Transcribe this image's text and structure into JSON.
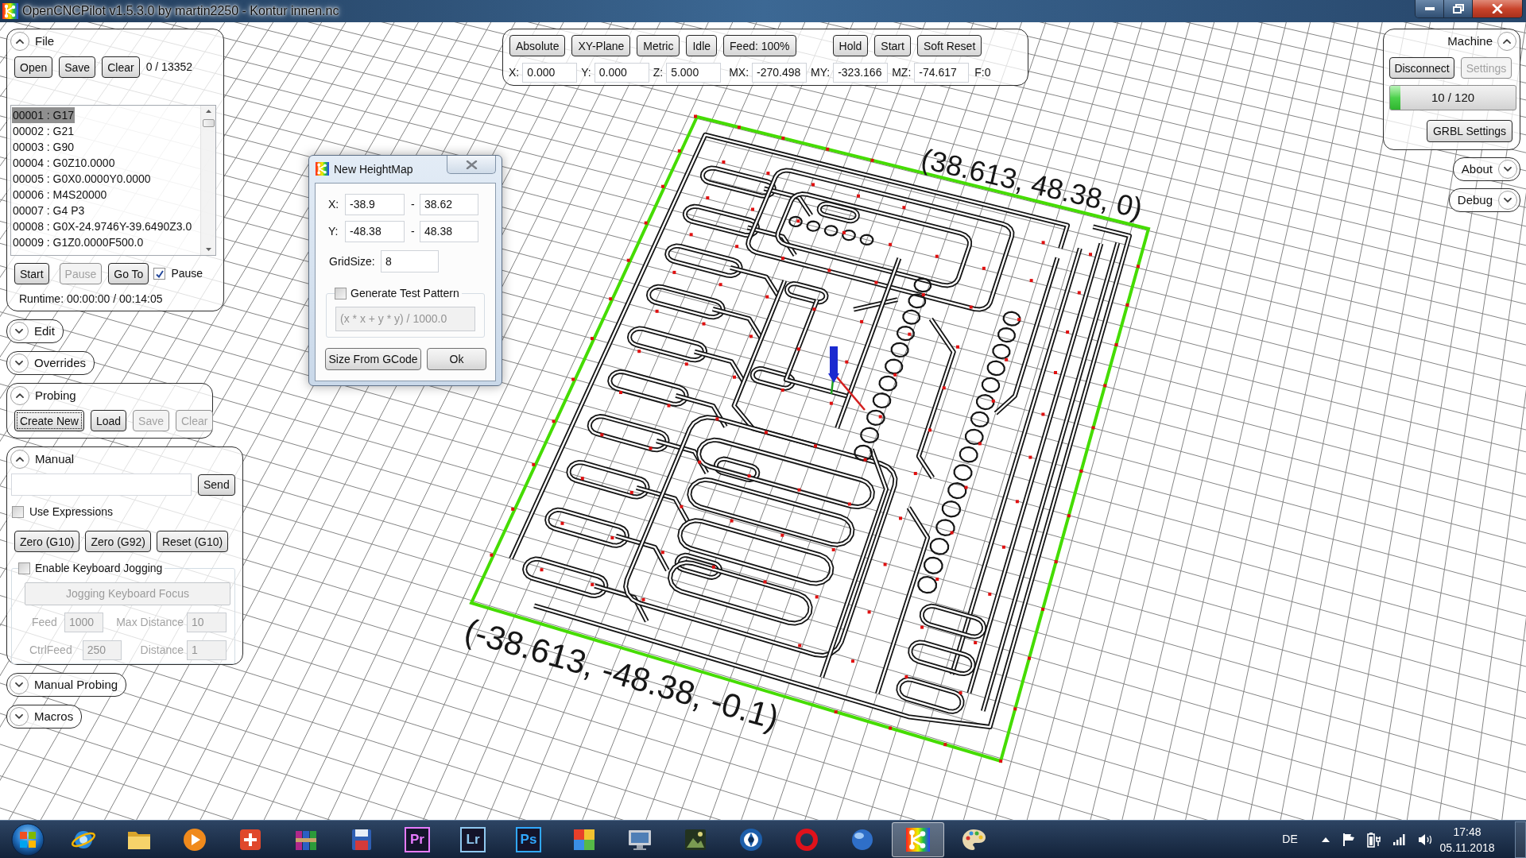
{
  "window": {
    "title": "OpenCNCPilot v1.5.3.0 by martin2250 - Kontur innen.nc"
  },
  "file_panel": {
    "title": "File",
    "expanded": true,
    "buttons": [
      {
        "label": "Open",
        "disabled": false
      },
      {
        "label": "Save",
        "disabled": false
      },
      {
        "label": "Clear",
        "disabled": false
      }
    ],
    "line_count": "0 / 13352",
    "lines": [
      {
        "text": "00001 : G17",
        "selected": true
      },
      {
        "text": "00002 : G21",
        "selected": false
      },
      {
        "text": "00003 : G90",
        "selected": false
      },
      {
        "text": "00004 : G0Z10.0000",
        "selected": false
      },
      {
        "text": "00005 : G0X0.0000Y0.0000",
        "selected": false
      },
      {
        "text": "00006 : M4S20000",
        "selected": false
      },
      {
        "text": "00007 : G4 P3",
        "selected": false
      },
      {
        "text": "00008 : G0X-24.9746Y-39.6490Z3.0",
        "selected": false
      },
      {
        "text": "00009 : G1Z0.0000F500.0",
        "selected": false
      }
    ],
    "run_buttons": [
      {
        "label": "Start",
        "disabled": false
      },
      {
        "label": "Pause",
        "disabled": true
      },
      {
        "label": "Go To",
        "disabled": false
      }
    ],
    "pause_option": {
      "label": "Pause",
      "checked": true
    },
    "runtime": "Runtime: 00:00:00 / 00:14:05"
  },
  "edit_panel": {
    "title": "Edit",
    "expanded": false
  },
  "overrides_panel": {
    "title": "Overrides",
    "expanded": false
  },
  "probing_panel": {
    "title": "Probing",
    "expanded": true,
    "buttons": [
      {
        "label": "Create New",
        "disabled": false,
        "focused": true
      },
      {
        "label": "Load",
        "disabled": false,
        "focused": false
      },
      {
        "label": "Save",
        "disabled": true,
        "focused": false
      },
      {
        "label": "Clear",
        "disabled": true,
        "focused": false
      }
    ]
  },
  "manual_panel": {
    "title": "Manual",
    "expanded": true,
    "send_button": "Send",
    "use_expressions": {
      "label": "Use Expressions",
      "checked": false
    },
    "buttons": [
      "Zero (G10)",
      "Zero (G92)",
      "Reset (G10)"
    ],
    "keyboard_jogging": {
      "label": "Enable Keyboard Jogging",
      "checked": false,
      "focus_button": "Jogging Keyboard Focus",
      "fields": [
        {
          "label": "Feed",
          "value": "1000"
        },
        {
          "label": "Max Distance",
          "value": "10"
        },
        {
          "label": "CtrlFeed",
          "value": "250"
        },
        {
          "label": "Distance",
          "value": "1"
        }
      ]
    }
  },
  "manual_probing_panel": {
    "title": "Manual Probing",
    "expanded": false
  },
  "macros_panel": {
    "title": "Macros",
    "expanded": false
  },
  "status_panel": {
    "mode_buttons": [
      "Absolute",
      "XY-Plane",
      "Metric",
      "Idle",
      "Feed: 100%"
    ],
    "control_buttons": [
      "Hold",
      "Start",
      "Soft Reset"
    ],
    "positions": [
      {
        "label": "X:",
        "value": "0.000"
      },
      {
        "label": "Y:",
        "value": "0.000"
      },
      {
        "label": "Z:",
        "value": "5.000"
      },
      {
        "label": "MX:",
        "value": "-270.498"
      },
      {
        "label": "MY:",
        "value": "-323.166"
      },
      {
        "label": "MZ:",
        "value": "-74.617"
      }
    ],
    "feed": "F:0"
  },
  "machine_panel": {
    "title": "Machine",
    "expanded": true,
    "buttons": [
      {
        "label": "Disconnect",
        "disabled": false
      },
      {
        "label": "Settings",
        "disabled": true
      }
    ],
    "buffer": {
      "level": 0.083,
      "text": "10 / 120"
    },
    "grbl_button": "GRBL Settings"
  },
  "about_panel": {
    "title": "About",
    "expanded": false
  },
  "debug_panel": {
    "title": "Debug",
    "expanded": false
  },
  "heightmap_dialog": {
    "title": "New HeightMap",
    "ranges": [
      {
        "label": "X:",
        "min": "-38.9",
        "separator": "-",
        "max": "38.62"
      },
      {
        "label": "Y:",
        "min": "-48.38",
        "separator": "-",
        "max": "48.38"
      }
    ],
    "grid_size": {
      "label": "GridSize:",
      "value": "8"
    },
    "test_pattern": {
      "label": "Generate Test Pattern",
      "checked": false,
      "expression": "(x * x + y * y) / 1000.0"
    },
    "buttons": [
      "Size From GCode",
      "Ok"
    ]
  },
  "viewport": {
    "corner_labels": [
      "(38.613, 48.38, 0)",
      "(-38.613, -48.38, -0.1)"
    ]
  },
  "taskbar": {
    "apps": [
      {
        "kind": "globe",
        "selected": false
      },
      {
        "kind": "folder",
        "selected": false
      },
      {
        "kind": "player",
        "selected": false
      },
      {
        "kind": "tile",
        "selected": false
      },
      {
        "kind": "books",
        "selected": false
      },
      {
        "kind": "floppy",
        "selected": false
      },
      {
        "kind": "letters",
        "label": "Pr",
        "color": "#e77bff",
        "selected": false
      },
      {
        "kind": "letters",
        "label": "Lr",
        "color": "#8fc8f0",
        "selected": false
      },
      {
        "kind": "letters",
        "label": "Ps",
        "color": "#31a8ff",
        "selected": false
      },
      {
        "kind": "gradient",
        "selected": false
      },
      {
        "kind": "monitor",
        "selected": false
      },
      {
        "kind": "picture",
        "selected": false
      },
      {
        "kind": "aperture",
        "selected": false
      },
      {
        "kind": "ring",
        "selected": false
      },
      {
        "kind": "sphere",
        "selected": false
      },
      {
        "kind": "cnc",
        "selected": true
      },
      {
        "kind": "palette",
        "selected": false
      }
    ],
    "tray": {
      "language": "DE",
      "time": "17:48",
      "date": "05.11.2018"
    }
  }
}
